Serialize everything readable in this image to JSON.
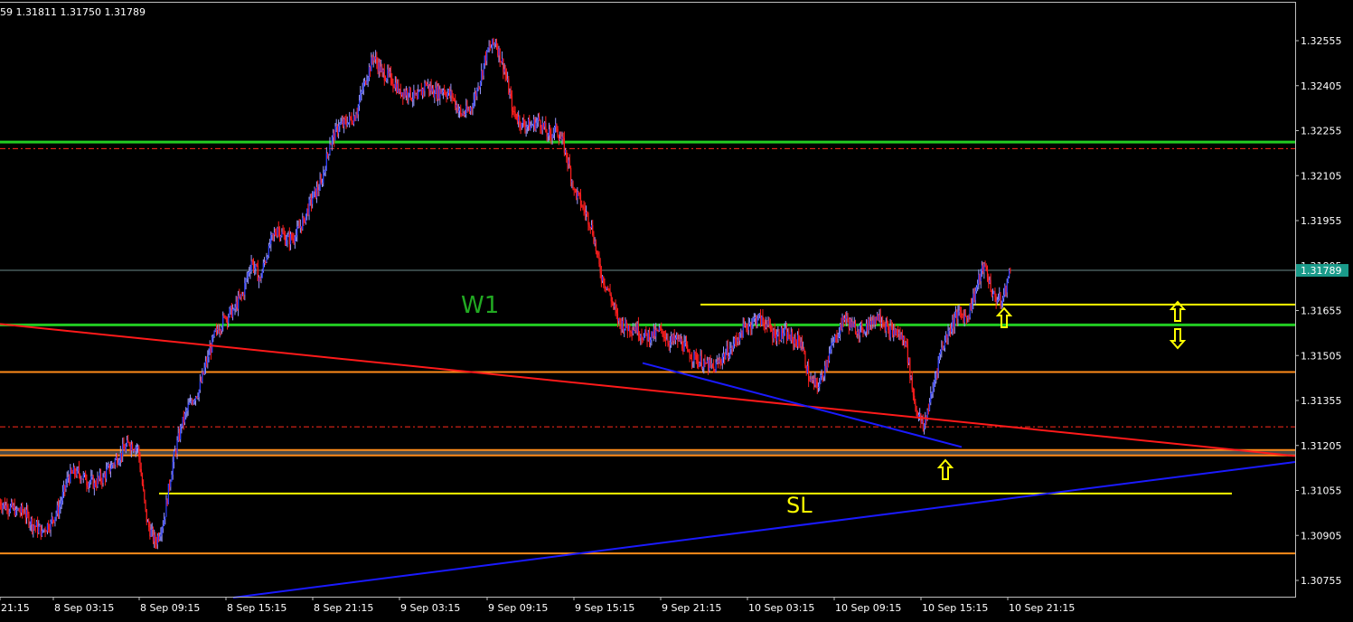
{
  "header": {
    "ohlc_text": "59 1.31811 1.31750 1.31789"
  },
  "price_axis": {
    "ticks": [
      "1.32555",
      "1.32405",
      "1.32255",
      "1.32105",
      "1.31955",
      "1.31805",
      "1.31655",
      "1.31505",
      "1.31355",
      "1.31205",
      "1.31055",
      "1.30905",
      "1.30755"
    ],
    "current_price_label": "1.31789"
  },
  "time_axis": {
    "ticks": [
      "21:15",
      "8 Sep 03:15",
      "8 Sep 09:15",
      "8 Sep 15:15",
      "8 Sep 21:15",
      "9 Sep 03:15",
      "9 Sep 09:15",
      "9 Sep 15:15",
      "9 Sep 21:15",
      "10 Sep 03:15",
      "10 Sep 09:15",
      "10 Sep 15:15",
      "10 Sep 21:15"
    ]
  },
  "annotations": {
    "w1": "W1",
    "sl": "SL"
  },
  "colors": {
    "background": "#000000",
    "frame": "#bfbfbf",
    "bull_candle": "#2a3cff",
    "bear_candle": "#ff1e1e",
    "wick": "#9a9aff",
    "green_level": "#22cc22",
    "orange_level": "#ff8c1a",
    "yellow_line": "#ffff00",
    "red_dash": "#ff2a1a",
    "red_trend": "#ff1a1a",
    "blue_trend": "#1a1aff",
    "price_label_bg": "#1a9a8a",
    "current_line": "#6a8a8a"
  },
  "chart_data": {
    "type": "candlestick",
    "symbol_ohlc": "59 1.31811 1.31750 1.31789",
    "current_price": 1.31789,
    "price_range": [
      1.307,
      1.3267
    ],
    "closes": [
      1.31,
      1.3099,
      1.3098,
      1.3094,
      1.3092,
      1.3095,
      1.31,
      1.311,
      1.3112,
      1.3109,
      1.3108,
      1.311,
      1.3114,
      1.3118,
      1.3121,
      1.312,
      1.3095,
      1.3088,
      1.3096,
      1.3115,
      1.3127,
      1.3135,
      1.3139,
      1.315,
      1.3159,
      1.3163,
      1.3166,
      1.3171,
      1.3182,
      1.3176,
      1.3187,
      1.3193,
      1.3189,
      1.319,
      1.3196,
      1.3203,
      1.3208,
      1.3221,
      1.3227,
      1.3228,
      1.3231,
      1.3242,
      1.325,
      1.3245,
      1.3243,
      1.3239,
      1.3238,
      1.3236,
      1.3241,
      1.3238,
      1.3239,
      1.3237,
      1.3231,
      1.3232,
      1.324,
      1.3252,
      1.3255,
      1.3246,
      1.3232,
      1.3228,
      1.3227,
      1.3229,
      1.3224,
      1.3226,
      1.3219,
      1.3206,
      1.32,
      1.3194,
      1.3178,
      1.3172,
      1.3162,
      1.316,
      1.316,
      1.3157,
      1.3157,
      1.3159,
      1.3155,
      1.3156,
      1.3152,
      1.3149,
      1.3148,
      1.3146,
      1.315,
      1.3153,
      1.3158,
      1.3161,
      1.3163,
      1.3161,
      1.3157,
      1.3158,
      1.3156,
      1.3155,
      1.3142,
      1.314,
      1.3149,
      1.3157,
      1.3163,
      1.316,
      1.3159,
      1.3162,
      1.3164,
      1.3159,
      1.3158,
      1.3155,
      1.3135,
      1.3126,
      1.3138,
      1.3152,
      1.3159,
      1.3165,
      1.3163,
      1.3172,
      1.3181,
      1.3171,
      1.3168,
      1.3179
    ],
    "levels": {
      "green": [
        1.32217,
        1.31607
      ],
      "orange": [
        1.3145,
        1.3119,
        1.31172,
        1.30845
      ],
      "red_dashed": [
        1.32195,
        1.31267
      ],
      "yellow": [
        1.31675,
        1.31045
      ]
    },
    "trendlines": [
      {
        "color": "red",
        "from": [
          "8 Sep 03:15 -",
          1.3161
        ],
        "to": [
          "10 Sep 21:15 +",
          1.3117
        ]
      },
      {
        "color": "blue",
        "from": [
          "8 Sep 15:15",
          1.3073
        ],
        "to": [
          "10 Sep 21:15 +",
          1.3115
        ]
      },
      {
        "color": "blue",
        "from": [
          "9 Sep 15:15 +",
          1.3148
        ],
        "to": [
          "10 Sep 15:15",
          1.312
        ]
      }
    ],
    "arrows": [
      {
        "direction": "up",
        "price": 1.3113
      },
      {
        "direction": "up",
        "price": 1.3164
      },
      {
        "direction": "up",
        "price": 1.3168
      },
      {
        "direction": "down",
        "price": 1.3154
      }
    ]
  }
}
